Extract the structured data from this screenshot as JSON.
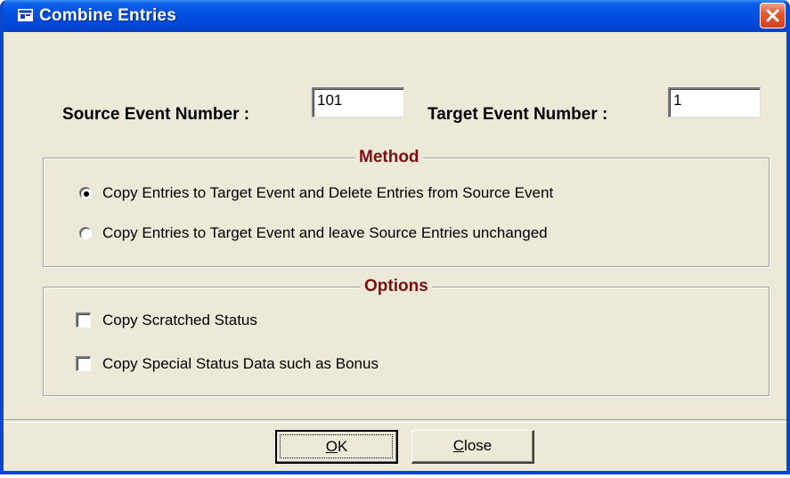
{
  "window": {
    "title": "Combine Entries",
    "icon": "window-app-icon",
    "close_icon": "close-icon"
  },
  "fields": {
    "source_label": "Source Event Number :",
    "source_value": "101",
    "target_label": "Target Event Number :",
    "target_value": "1"
  },
  "method": {
    "title": "Method",
    "options": [
      {
        "label": "Copy Entries to Target Event and Delete Entries from Source Event",
        "selected": true
      },
      {
        "label": "Copy Entries to Target Event and leave Source Entries unchanged",
        "selected": false
      }
    ]
  },
  "options": {
    "title": "Options",
    "items": [
      {
        "label": "Copy Scratched Status",
        "checked": false
      },
      {
        "label": "Copy Special Status Data such as Bonus",
        "checked": false
      }
    ]
  },
  "buttons": {
    "ok_mnemonic": "O",
    "ok_rest": "K",
    "close_mnemonic": "C",
    "close_rest": "lose"
  },
  "colors": {
    "titlebar": "#0050df",
    "dialog_bg": "#ece9d8",
    "group_title": "#7a1010",
    "close_button": "#d2431c"
  }
}
